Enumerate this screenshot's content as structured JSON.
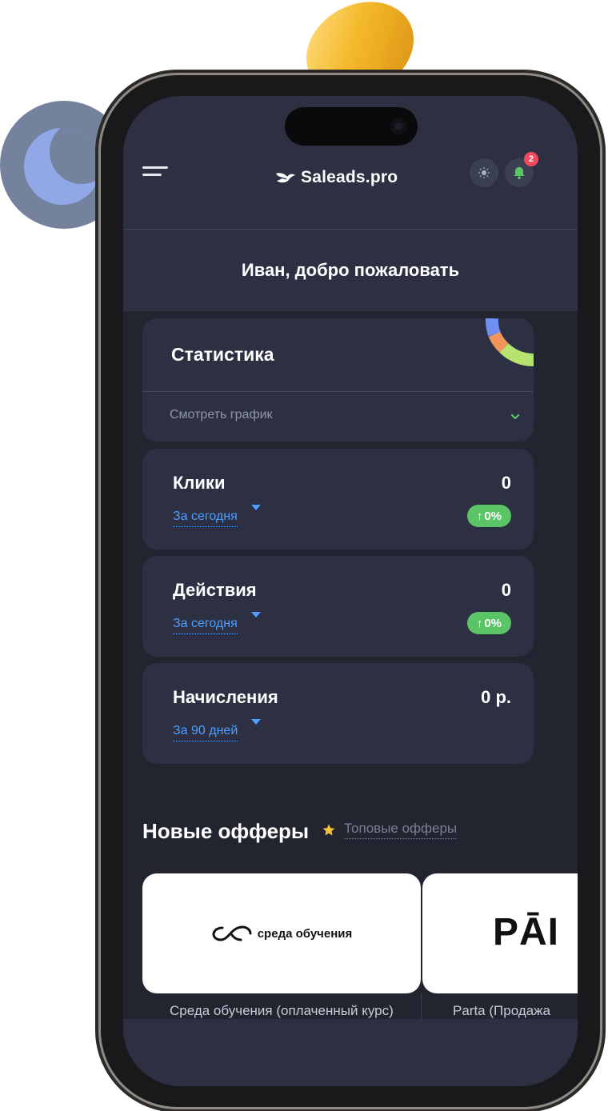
{
  "header": {
    "brand": "Saleads.pro",
    "notifications_count": "2"
  },
  "welcome": "Иван, добро пожаловать",
  "stats": {
    "title": "Статистика",
    "link": "Смотреть график"
  },
  "metrics": [
    {
      "title": "Клики",
      "value": "0",
      "period": "За сегодня",
      "growth": "0%"
    },
    {
      "title": "Действия",
      "value": "0",
      "period": "За сегодня",
      "growth": "0%"
    },
    {
      "title": "Начисления",
      "value": "0 р.",
      "period": "За 90 дней"
    }
  ],
  "offers": {
    "title": "Новые офферы",
    "top_link": "Топовые офферы",
    "items": [
      {
        "name": "Среда обучения (оплаченный курс)",
        "logo_text": "среда обучения"
      },
      {
        "name": "Parta (Продажа",
        "logo_text": "PĀI"
      }
    ]
  },
  "colors": {
    "screen_bg": "#2c3042",
    "content_bg": "#22252f",
    "accent_blue": "#4e9eff",
    "success_green": "#5bc466",
    "badge_red": "#f2495d"
  }
}
